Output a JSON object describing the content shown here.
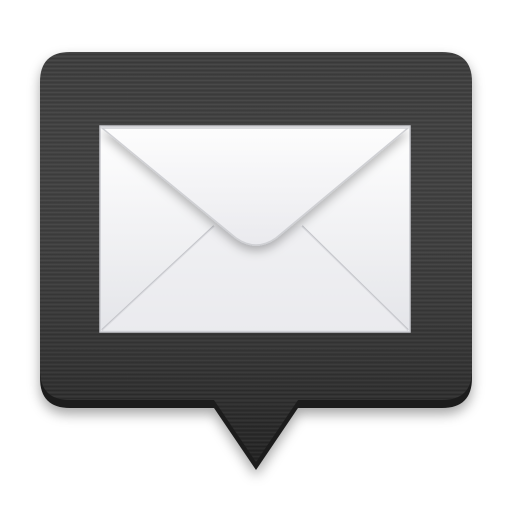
{
  "icon": {
    "name": "mail-notification-icon",
    "colors": {
      "bubble_dark": "#2a2a2a",
      "bubble_mid": "#3a3a3a",
      "bubble_edge": "#1a1a1a",
      "envelope_light": "#f7f7f9",
      "envelope_shade": "#dcdde2",
      "envelope_border": "#c7c8cc"
    }
  }
}
